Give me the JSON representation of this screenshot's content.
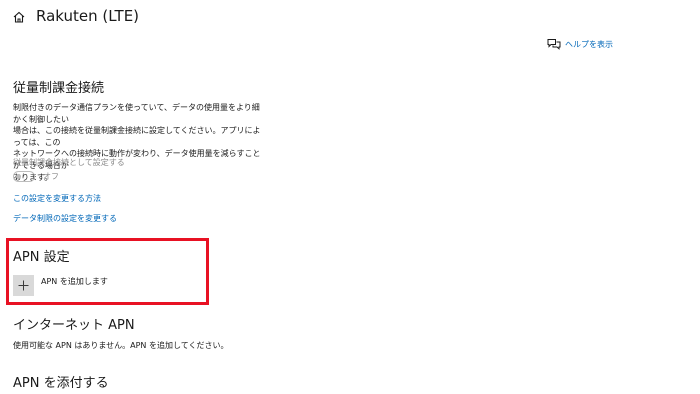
{
  "header": {
    "title": "Rakuten (LTE)",
    "home_icon": "home-icon"
  },
  "help": {
    "label": "ヘルプを表示",
    "icon": "chat-help-icon"
  },
  "metered": {
    "heading": "従量制課金接続",
    "description_lines": [
      "制限付きのデータ通信プランを使っていて、データの使用量をより細かく制御したい",
      "場合は、この接続を従量制課金接続に設定してください。アプリによっては、この",
      "ネットワークへの接続時に動作が変わり、データ使用量を減らすことができる場合が",
      "あります。"
    ],
    "toggle_label": "従量制課金接続として設定する",
    "toggle_state": "オフ",
    "link_change": "この設定を変更する方法",
    "link_data_limit": "データ制限の設定を変更する"
  },
  "apn_settings": {
    "heading": "APN 設定",
    "add_label": "APN を追加します"
  },
  "internet_apn": {
    "heading": "インターネット APN",
    "empty_text": "使用可能な APN はありません。APN を追加してください。"
  },
  "attach_apn": {
    "heading": "APN を添付する"
  },
  "colors": {
    "accent": "#0067b8",
    "highlight": "#e81123",
    "button_bg": "#d9d9d9"
  }
}
